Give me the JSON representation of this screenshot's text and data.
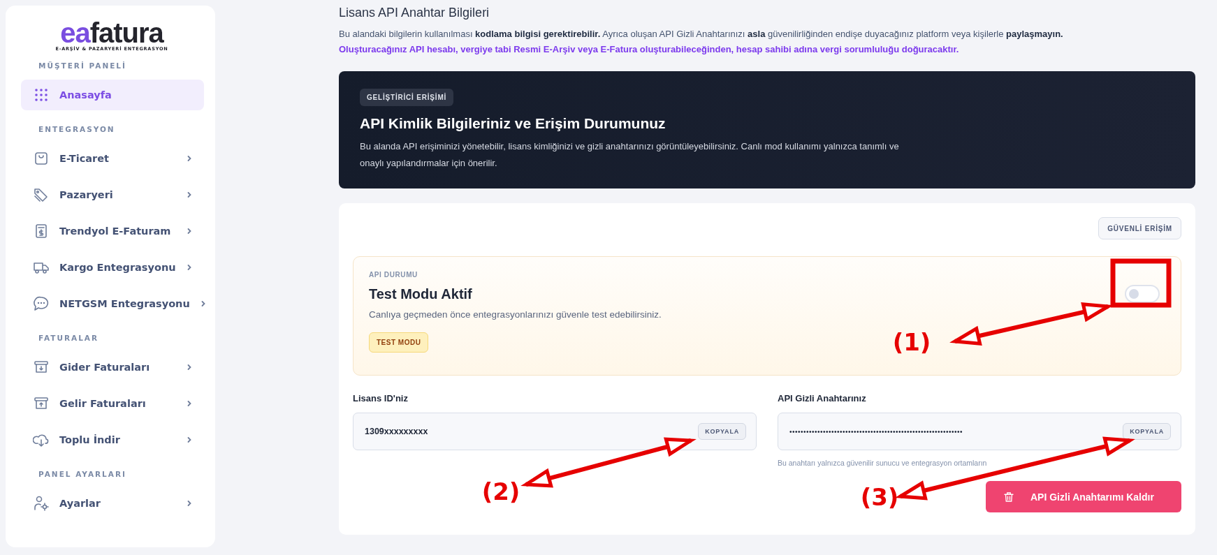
{
  "logo": {
    "part_1": "ea",
    "part_2": "fatura",
    "tagline": "E-ARŞİV & PAZARYERİ ENTEGRASYON"
  },
  "sidebar": {
    "sections": [
      {
        "title": "MÜŞTERİ PANELİ",
        "items": [
          {
            "label": "Anasayfa",
            "selected": true,
            "chevron": false
          }
        ]
      },
      {
        "title": "ENTEGRASYON",
        "items": [
          {
            "label": "E-Ticaret",
            "selected": false,
            "chevron": true
          },
          {
            "label": "Pazaryeri",
            "selected": false,
            "chevron": true
          },
          {
            "label": "Trendyol E-Faturam",
            "selected": false,
            "chevron": true
          },
          {
            "label": "Kargo Entegrasyonu",
            "selected": false,
            "chevron": true
          },
          {
            "label": "NETGSM Entegrasyonu",
            "selected": false,
            "chevron": true
          }
        ]
      },
      {
        "title": "FATURALAR",
        "items": [
          {
            "label": "Gider Faturaları",
            "selected": false,
            "chevron": true
          },
          {
            "label": "Gelir Faturaları",
            "selected": false,
            "chevron": true
          },
          {
            "label": "Toplu İndir",
            "selected": false,
            "chevron": true
          }
        ]
      },
      {
        "title": "PANEL AYARLARI",
        "items": [
          {
            "label": "Ayarlar",
            "selected": false,
            "chevron": true
          }
        ]
      }
    ]
  },
  "page": {
    "title": "Lisans API Anahtar Bilgileri",
    "intro": "Bu alandaki bilgilerin kullanılması **kodlama bilgisi gerektirebilir.** Ayrıca oluşan API Gizli Anahtarınızı **asla** güvenilirliğinden endişe duyacağınız platform veya kişilerle **paylaşmayın.**",
    "warning": "Oluşturacağınız API hesabı, vergiye tabi Resmi E-Arşiv veya E-Fatura oluşturabileceğinden, hesap sahibi adına vergi sorumluluğu doğuracaktır."
  },
  "hero": {
    "badge": "GELİŞTİRİCİ ERİŞİMİ",
    "title": "API Kimlik Bilgileriniz ve Erişim Durumunuz",
    "description": "Bu alanda API erişiminizi yönetebilir, lisans kimliğinizi ve gizli anahtarınızı görüntüleyebilirsiniz. Canlı mod kullanımı yalnızca tanımlı ve onaylı yapılandırmalar için önerilir."
  },
  "secure_button": "GÜVENLİ ERİŞİM",
  "status": {
    "label": "API DURUMU",
    "title": "Test Modu Aktif",
    "description": "Canlıya geçmeden önce entegrasyonlarınızı güvenle test edebilirsiniz.",
    "badge": "TEST MODU",
    "on": false
  },
  "fields": [
    {
      "label": "Lisans ID'niz",
      "value": "1309xxxxxxxxx",
      "copy": "KOPYALA",
      "kind": "plain"
    },
    {
      "label": "API Gizli Anahtarınız",
      "value": "••••••••••••••••••••••••••••••••••••••••••••••••••••••••••••••",
      "copy": "KOPYALA",
      "kind": "secret",
      "hint": "Bu anahtarı yalnızca güvenilir sunucu ve entegrasyon ortamların"
    }
  ],
  "delete_button": "API Gizli Anahtarımı Kaldır",
  "annotations": [
    {
      "label": "(1)"
    },
    {
      "label": "(2)"
    },
    {
      "label": "(3)"
    }
  ]
}
